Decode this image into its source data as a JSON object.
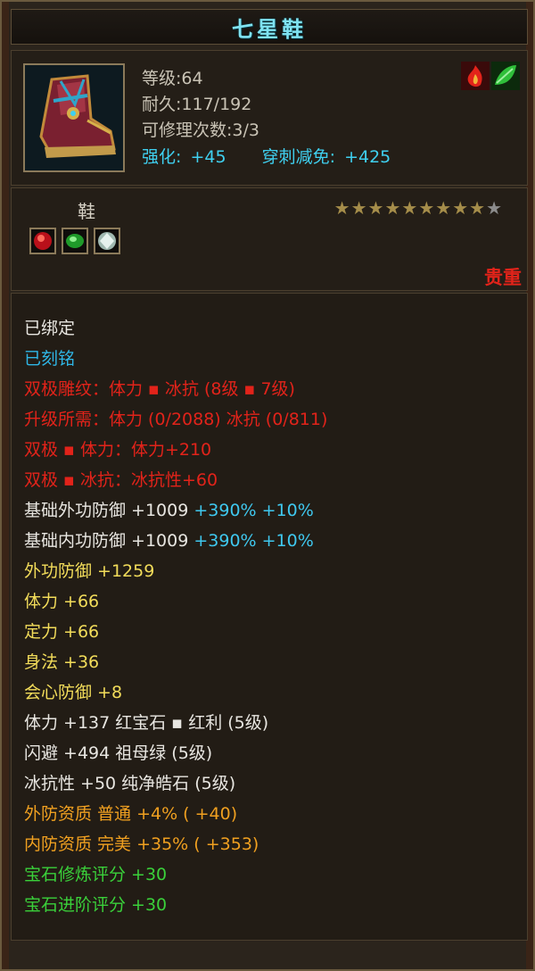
{
  "item": {
    "name": "七星鞋",
    "level_line": "等级:64",
    "durability_line": "耐久:117/192",
    "repair_line": "可修理次数:3/3",
    "enhance_label": "强化:",
    "enhance_value": "+45",
    "pierce_label": "穿刺减免:",
    "pierce_value": "+425",
    "type": "鞋",
    "rarity": "贵重",
    "stars_filled": 9,
    "stars_total": 10,
    "element_icons": [
      "fire-element-icon",
      "wood-element-icon"
    ],
    "gem_slots": [
      "ruby-gem-icon",
      "emerald-gem-icon",
      "diamond-gem-icon"
    ]
  },
  "stats": {
    "bound": "已绑定",
    "engraved": "已刻铭",
    "carve": "双极雕纹：体力 ▪ 冰抗 (8级 ▪ 7级)",
    "upgrade": "升级所需：体力 (0/2088)  冰抗 (0/811)",
    "dual_vit": "双极 ▪ 体力：体力+210",
    "dual_ice": "双极 ▪ 冰抗：冰抗性+60",
    "base_ext_a": "基础外功防御 +1009 ",
    "base_ext_b": "+390% +10%",
    "base_int_a": "基础内功防御 +1009 ",
    "base_int_b": "+390% +10%",
    "ext_def": "外功防御 +1259",
    "vit": "体力 +66",
    "focus": "定力 +66",
    "agility": "身法 +36",
    "crit_def": "会心防御 +8",
    "gem1": "体力 +137 红宝石 ▪ 红利 (5级)",
    "gem2": "闪避 +494 祖母绿 (5级)",
    "gem3": "冰抗性 +50 纯净皓石 (5级)",
    "q1": "外防资质  普通 +4% ( +40)",
    "q2": "内防资质  完美 +35% ( +353)",
    "score1": "宝石修炼评分 +30",
    "score2": "宝石进阶评分 +30"
  },
  "colors": {
    "title": "#7fe3f2",
    "accent_cyan": "#3fd0f0",
    "red": "#e2231a",
    "yellow": "#f2dc5a",
    "orange": "#f0a020",
    "green": "#3ad03a"
  }
}
